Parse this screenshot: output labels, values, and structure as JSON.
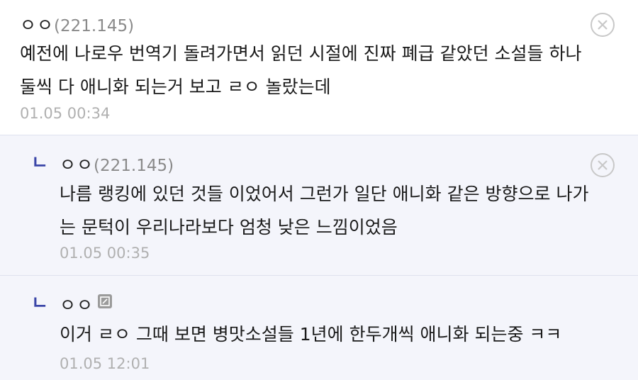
{
  "comments": [
    {
      "nick": "ㅇㅇ",
      "ip": "(221.145)",
      "lines": [
        "예전에 나로우 번역기 돌려가면서 읽던 시절에 진짜 폐급 같았던 소설들 하나",
        "둘씩 다 애니화 되는거 보고 ㄹㅇ 놀랐는데"
      ],
      "date": "01.05 00:34"
    },
    {
      "reply_mark": "ㄴ",
      "nick": "ㅇㅇ",
      "ip": "(221.145)",
      "lines": [
        "나름 랭킹에 있던 것들 이었어서 그런가 일단 애니화 같은 방향으로 나가",
        "는 문턱이 우리나라보다 엄청 낮은 느낌이었음"
      ],
      "date": "01.05 00:35"
    },
    {
      "reply_mark": "ㄴ",
      "nick": "ㅇㅇ",
      "lines": [
        "이거 ㄹㅇ 그때 보면 병맛소설들 1년에 한두개씩 애니화 되는중 ㅋㅋ"
      ],
      "date": "01.05 12:01"
    }
  ],
  "colors": {
    "reply_bg": "#f4f5fb",
    "reply_mark": "#3b46a8",
    "date": "#b0b0b0",
    "ip": "#8a8a8a"
  },
  "icons": {
    "delete": "close-circle-icon",
    "member": "fixed-nick-icon"
  }
}
